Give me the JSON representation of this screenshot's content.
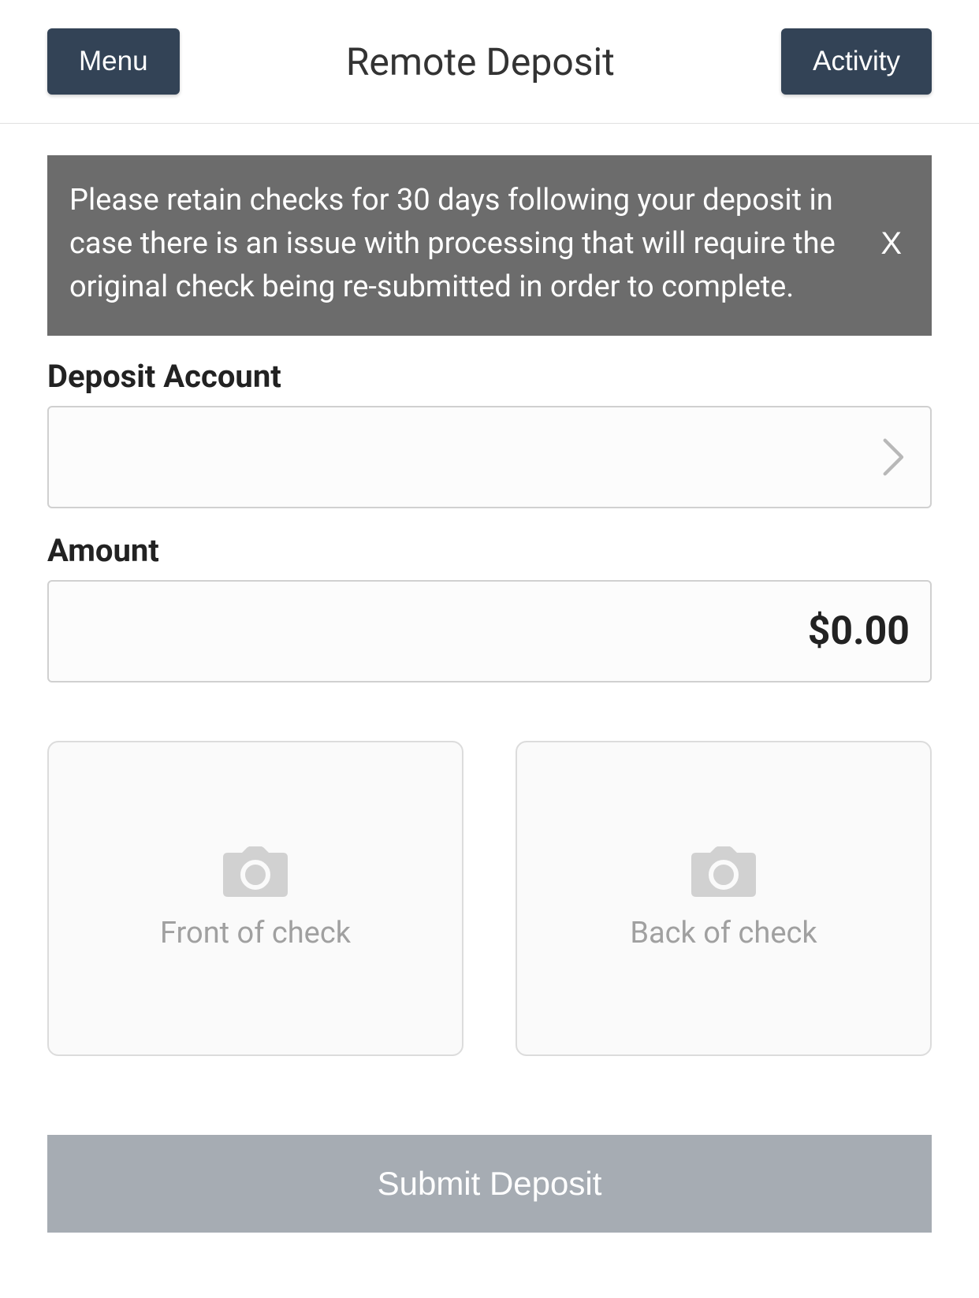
{
  "header": {
    "menu_label": "Menu",
    "title": "Remote Deposit",
    "activity_label": "Activity"
  },
  "notice": {
    "text": "Please retain checks for 30 days following your deposit in case there is an issue with processing that will require the original check being re-submitted in order to complete.",
    "close_label": "X"
  },
  "form": {
    "deposit_account_label": "Deposit Account",
    "deposit_account_value": "",
    "amount_label": "Amount",
    "amount_value": "$0.00",
    "front_label": "Front of check",
    "back_label": "Back of check",
    "submit_label": "Submit Deposit"
  }
}
